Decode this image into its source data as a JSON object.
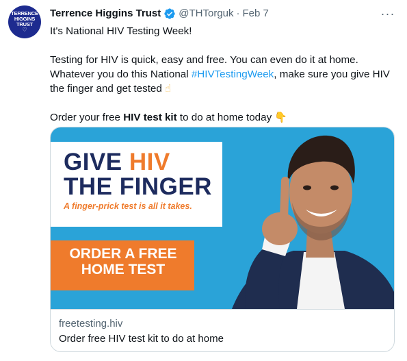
{
  "tweet": {
    "author": {
      "avatar_lines": [
        "TERRENCE",
        "HIGGINS",
        "TRUST"
      ],
      "avatar_icon": "heart-icon",
      "name": "Terrence Higgins Trust",
      "verified_icon": "verified-badge-icon",
      "handle": "@THTorguk",
      "separator": "·",
      "date": "Feb 7"
    },
    "more_icon": "more-dots-icon",
    "more_label": "···",
    "text": {
      "line1": "It's National HIV Testing Week!",
      "p2_part1": "Testing for HIV is quick, easy and free. You can even do it at home. Whatever you do this National ",
      "hashtag": "#HIVTestingWeek",
      "p2_part2": ", make sure you give HIV the finger and get tested ",
      "emoji_up": "☝",
      "p3_part1": "Order your free ",
      "p3_bold": "HIV test kit",
      "p3_part2": " to do at home today ",
      "emoji_down": "👇"
    },
    "card": {
      "image": {
        "headline_give": "GIVE ",
        "headline_hiv": "HIV",
        "headline_finger": "THE FINGER",
        "tagline": "A finger-prick test is all it takes.",
        "cta": "ORDER A FREE HOME TEST",
        "colors": {
          "background": "#2aa3d8",
          "navy": "#1d2b5e",
          "orange": "#ef7b2c"
        }
      },
      "domain": "freetesting.hiv",
      "title": "Order free HIV test kit to do at home"
    },
    "colors": {
      "link": "#1d9bf0",
      "secondary_text": "#536471",
      "avatar_bg": "#1d2b8f"
    }
  }
}
